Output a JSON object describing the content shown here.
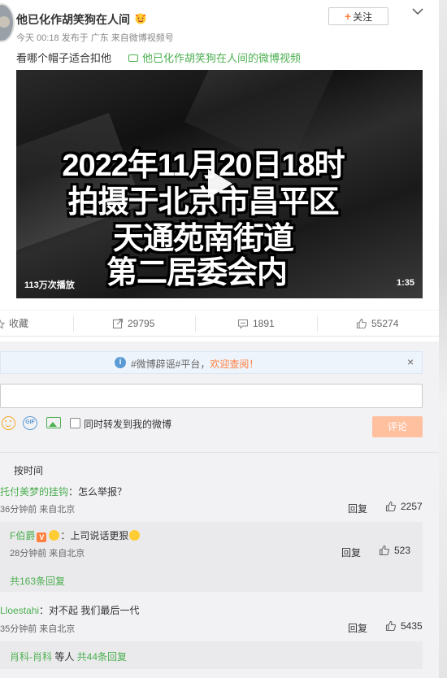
{
  "post": {
    "username": "他已化作胡笑狗在人间",
    "meta": "今天 00:18 发布于 广东 来自微博视频号",
    "follow_label": "关注",
    "text": "看哪个帽子适合扣他",
    "video_link": "他已化作胡笑狗在人间的微博视频",
    "video": {
      "overlay_lines": [
        "2022年11月20日18时",
        "拍摄于北京市昌平区",
        "天通苑南街道",
        "第二居委会内"
      ],
      "plays": "113万次播放",
      "duration": "1:35"
    }
  },
  "actions": {
    "favorite": "收藏",
    "repost": "29795",
    "comment": "1891",
    "like": "55274"
  },
  "comments": {
    "notice_prefix": "#微博辟谣#平台，",
    "notice_link": "欢迎查阅！",
    "sync_label": "同时转发到我的微博",
    "submit_label": "评论",
    "sort_label": "按时间",
    "items": [
      {
        "user": "托付美梦的挂钩",
        "text": "：怎么举报？",
        "meta": "36分钟前 来自北京",
        "reply": "回复",
        "likes": "2257",
        "sub": {
          "user": "F伯爵",
          "text": "：上司说话更狠",
          "meta": "28分钟前 来自北京",
          "reply": "回复",
          "likes": "523",
          "more": "共163条回复"
        }
      },
      {
        "user": "Lloestahi",
        "text": "：对不起 我们最后一代",
        "meta": "35分钟前 来自北京",
        "reply": "回复",
        "likes": "5435",
        "sub": {
          "names": "肖科-肖科",
          "mid": " 等人 ",
          "more": "共44条回复"
        }
      }
    ]
  },
  "colors": {
    "accent": "#ff8140",
    "link": "#4caf50",
    "notice_icon": "#5b9bd5"
  }
}
